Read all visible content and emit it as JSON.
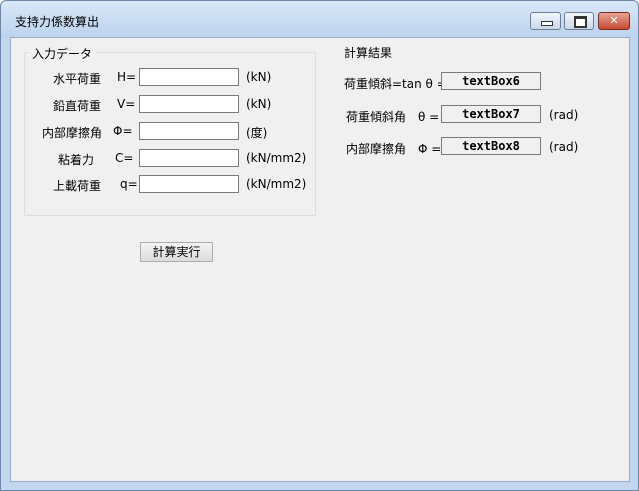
{
  "window": {
    "title": "支持力係数算出",
    "controls": {
      "minimize": "minimize-icon",
      "maximize": "maximize-icon",
      "close": "close-icon"
    }
  },
  "input_group": {
    "title": "入力データ",
    "fields": [
      {
        "label": "水平荷重",
        "symbol": "H=",
        "value": "",
        "unit": "(kN)"
      },
      {
        "label": "鉛直荷重",
        "symbol": "V=",
        "value": "",
        "unit": "(kN)"
      },
      {
        "label": "内部摩擦角",
        "symbol": "Φ=",
        "value": "",
        "unit": "(度)"
      },
      {
        "label": "粘着力",
        "symbol": "C=",
        "value": "",
        "unit": "(kN/mm2)"
      },
      {
        "label": "上載荷重",
        "symbol": "q=",
        "value": "",
        "unit": "(kN/mm2)"
      }
    ]
  },
  "results": {
    "title": "計算結果",
    "rows": [
      {
        "label": "荷重傾斜=tan θ =",
        "value": "textBox6",
        "unit": ""
      },
      {
        "label": "荷重傾斜角　θ =",
        "value": "textBox7",
        "unit": "(rad)"
      },
      {
        "label": "内部摩擦角　Φ =",
        "value": "textBox8",
        "unit": "(rad)"
      }
    ]
  },
  "actions": {
    "calculate_label": "計算実行"
  },
  "colors": {
    "titlebar": "#bcd3ee",
    "client": "#f0f0f0",
    "close_button": "#c74a33"
  }
}
